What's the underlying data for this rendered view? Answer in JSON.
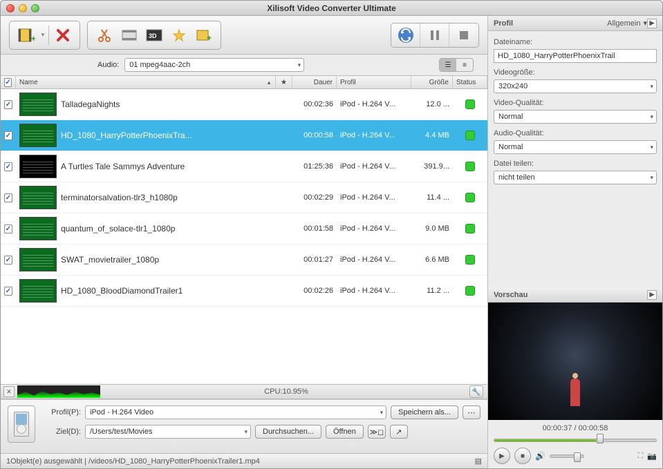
{
  "title": "Xilisoft Video Converter Ultimate",
  "audio_label": "Audio:",
  "audio_value": "01 mpeg4aac-2ch",
  "columns": {
    "name": "Name",
    "duration": "Dauer",
    "profile": "Profil",
    "size": "Größe",
    "status": "Status"
  },
  "rows": [
    {
      "checked": true,
      "thumb": "green",
      "name": "TalladegaNights",
      "duration": "00:02:36",
      "profile": "iPod - H.264 V...",
      "size": "12.0 ..."
    },
    {
      "checked": true,
      "thumb": "green",
      "name": "HD_1080_HarryPotterPhoenixTra...",
      "duration": "00:00:58",
      "profile": "iPod - H.264 V...",
      "size": "4.4 MB",
      "selected": true
    },
    {
      "checked": true,
      "thumb": "dark",
      "name": "A Turtles Tale Sammys Adventure",
      "duration": "01:25:36",
      "profile": "iPod - H.264 V...",
      "size": "391.9..."
    },
    {
      "checked": true,
      "thumb": "green",
      "name": "terminatorsalvation-tlr3_h1080p",
      "duration": "00:02:29",
      "profile": "iPod - H.264 V...",
      "size": "11.4 ..."
    },
    {
      "checked": true,
      "thumb": "green",
      "name": "quantum_of_solace-tlr1_1080p",
      "duration": "00:01:58",
      "profile": "iPod - H.264 V...",
      "size": "9.0 MB"
    },
    {
      "checked": true,
      "thumb": "green",
      "name": "SWAT_movietrailer_1080p",
      "duration": "00:01:27",
      "profile": "iPod - H.264 V...",
      "size": "6.6 MB"
    },
    {
      "checked": true,
      "thumb": "green",
      "name": "HD_1080_BloodDiamondTrailer1",
      "duration": "00:02:26",
      "profile": "iPod - H.264 V...",
      "size": "11.2 ..."
    }
  ],
  "cpu_label": "CPU:10.95%",
  "bottom": {
    "profile_label": "Profil(P):",
    "profile_value": "iPod - H.264 Video",
    "save_as": "Speichern als...",
    "dest_label": "Ziel(D):",
    "dest_value": "/Users/test/Movies",
    "browse": "Durchsuchen...",
    "open": "Öffnen"
  },
  "status_bar": "1Objekt(e) ausgewählt | /videos/HD_1080_HarryPotterPhoenixTrailer1.mp4",
  "side": {
    "profil": "Profil",
    "allgemein": "Allgemein",
    "dateiname": "Dateiname:",
    "dateiname_value": "HD_1080_HarryPotterPhoenixTrail",
    "videogroesse": "Videogröße:",
    "videogroesse_value": "320x240",
    "video_quality": "Video-Qualität:",
    "video_quality_value": "Normal",
    "audio_quality": "Audio-Qualität:",
    "audio_quality_value": "Normal",
    "datei_teilen": "Datei teilen:",
    "datei_teilen_value": "nicht teilen",
    "vorschau": "Vorschau",
    "time": "00:00:37 / 00:00:58"
  }
}
